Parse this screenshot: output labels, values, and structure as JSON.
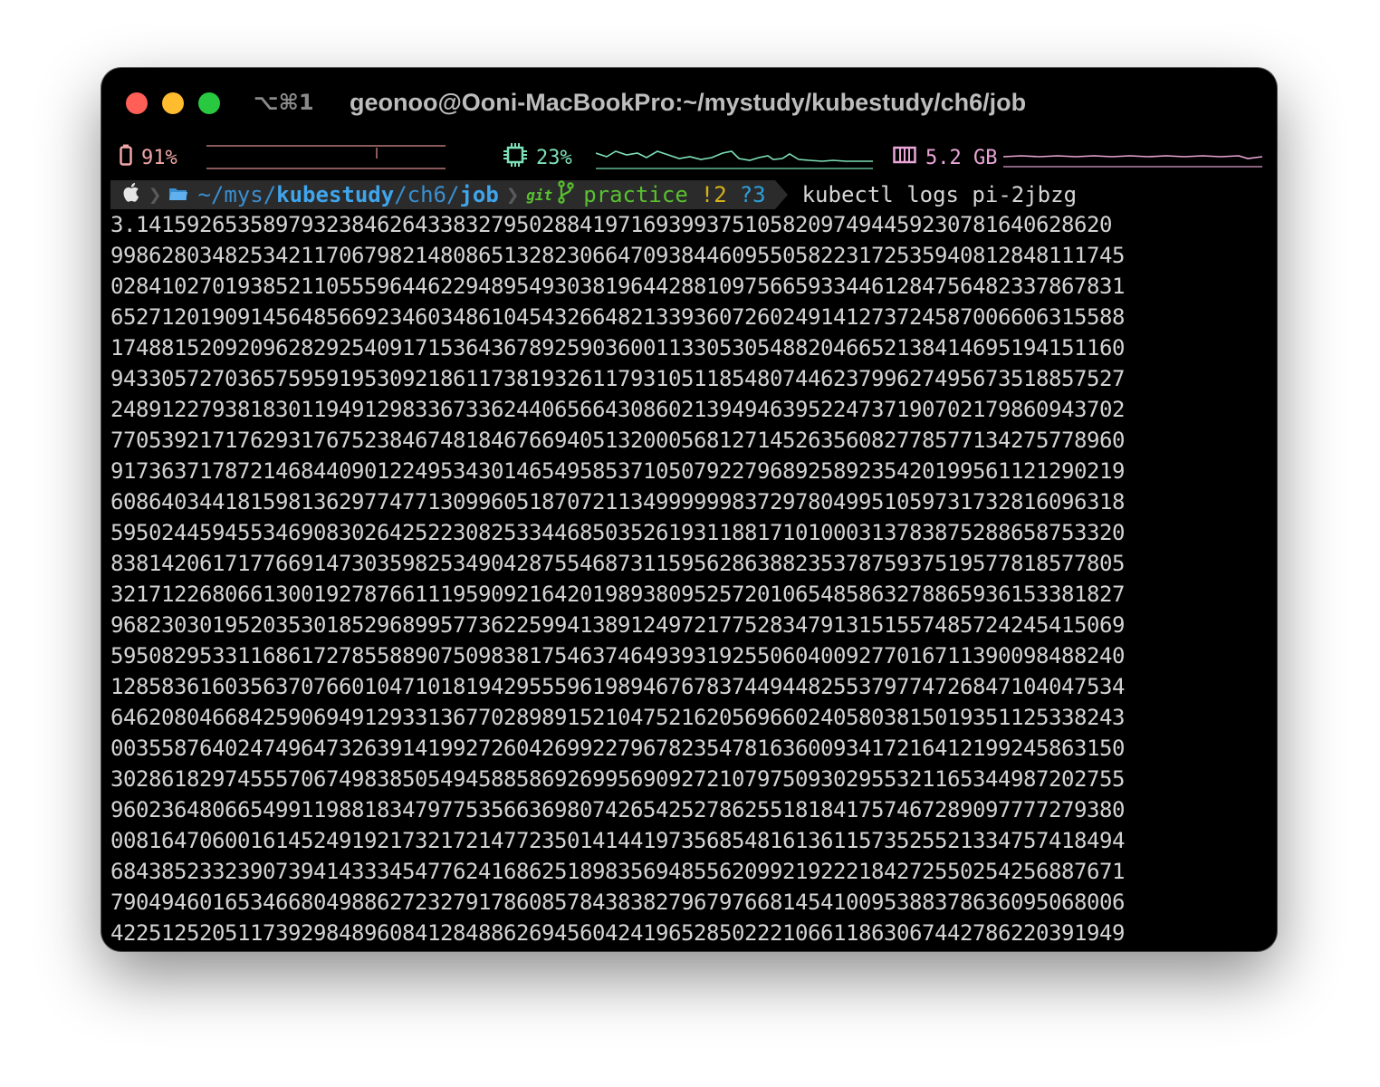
{
  "window": {
    "shortcut": "⌥⌘1",
    "title": "geonoo@Ooni-MacBookPro:~/mystudy/kubestudy/ch6/job"
  },
  "status": {
    "battery": {
      "icon": "battery-icon",
      "value": "91%",
      "color": "#f0a6a6"
    },
    "cpu": {
      "icon": "cpu-chip-icon",
      "value": "23%",
      "color": "#7ee0b6"
    },
    "memory": {
      "icon": "memory-icon",
      "value": "5.2 GB",
      "color": "#e9a6d6"
    }
  },
  "prompt": {
    "os_icon": "apple-icon",
    "folder_icon": "folder-icon",
    "path_prefix": "~/mys/",
    "path_mid": "kubestudy",
    "path_slash": "/",
    "path_ch": "ch6",
    "path_slash2": "/",
    "path_last": "job",
    "git_label": "git",
    "branch_icon": "git-branch-icon",
    "branch": "practice",
    "modified": "!2",
    "untracked": "?3",
    "command": "kubectl logs pi-2jbzg"
  },
  "output": {
    "lines": [
      "3.14159265358979323846264338327950288419716939937510582097494459230781640628620",
      "99862803482534211706798214808651328230664709384460955058223172535940812848111745",
      "02841027019385211055596446229489549303819644288109756659334461284756482337867831",
      "65271201909145648566923460348610454326648213393607260249141273724587006606315588",
      "17488152092096282925409171536436789259036001133053054882046652138414695194151160",
      "94330572703657595919530921861173819326117931051185480744623799627495673518857527",
      "24891227938183011949129833673362440656643086021394946395224737190702179860943702",
      "77053921717629317675238467481846766940513200056812714526356082778577134275778960",
      "91736371787214684409012249534301465495853710507922796892589235420199561121290219",
      "60864034418159813629774771309960518707211349999998372978049951059731732816096318",
      "59502445945534690830264252230825334468503526193118817101000313783875288658753320",
      "83814206171776691473035982534904287554687311595628638823537875937519577818577805",
      "32171226806613001927876611195909216420198938095257201065485863278865936153381827",
      "96823030195203530185296899577362259941389124972177528347913151557485724245415069",
      "59508295331168617278558890750983817546374649393192550604009277016711390098488240",
      "12858361603563707660104710181942955596198946767837449448255379774726847104047534",
      "64620804668425906949129331367702898915210475216205696602405803815019351125338243",
      "00355876402474964732639141992726042699227967823547816360093417216412199245863150",
      "30286182974555706749838505494588586926995690927210797509302955321165344987202755",
      "96023648066549911988183479775356636980742654252786255181841757467289097777279380",
      "00816470600161452491921732172147723501414419735685481613611573525521334757418494",
      "68438523323907394143334547762416862518983569485562099219222184272550254256887671",
      "79049460165346680498862723279178608578438382796797668145410095388378636095068006",
      "42251252051173929848960841284886269456042419652850222106611863067442786220391949"
    ]
  }
}
